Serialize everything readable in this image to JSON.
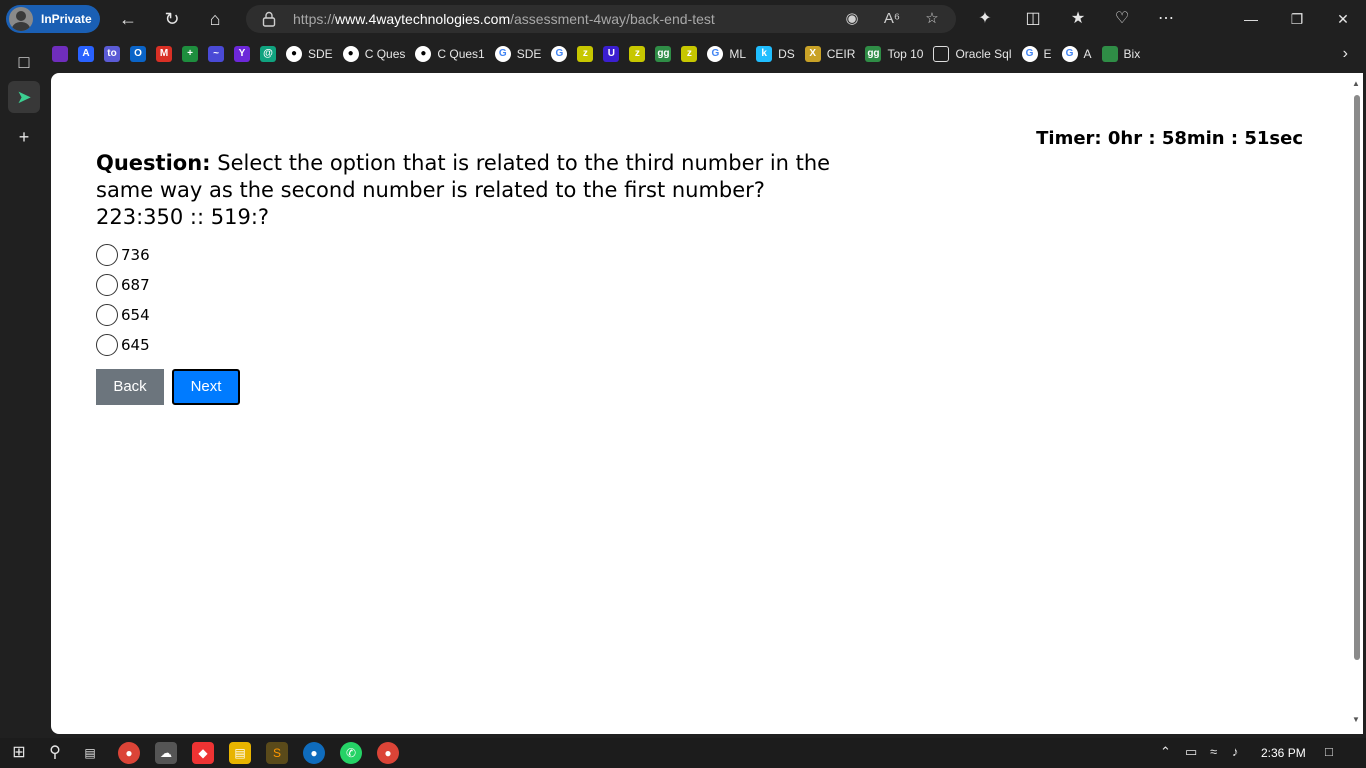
{
  "browser": {
    "profile_label": "InPrivate",
    "url_prefix": "https://",
    "url_host": "www.4waytechnologies.com",
    "url_path": "/assessment-4way/back-end-test"
  },
  "favorites": [
    {
      "label": "",
      "icon": "shield-purple",
      "color": "#6f2dbd"
    },
    {
      "label": "",
      "icon": "A",
      "color": "#2962ff"
    },
    {
      "label": "",
      "icon": "to",
      "color": "#5b5bd6"
    },
    {
      "label": "",
      "icon": "O",
      "color": "#0a64c8"
    },
    {
      "label": "",
      "icon": "M",
      "color": "#d93025"
    },
    {
      "label": "",
      "icon": "+",
      "color": "#1e8e3e"
    },
    {
      "label": "",
      "icon": "~",
      "color": "#4a4ad6"
    },
    {
      "label": "",
      "icon": "Y",
      "color": "#6d28d9"
    },
    {
      "label": "",
      "icon": "@",
      "color": "#10a37f"
    },
    {
      "label": "SDE",
      "icon": "github",
      "color": "#000000"
    },
    {
      "label": "C Ques",
      "icon": "github",
      "color": "#000000"
    },
    {
      "label": "C Ques1",
      "icon": "github",
      "color": "#000000"
    },
    {
      "label": "SDE",
      "icon": "G",
      "color": "#4285f4"
    },
    {
      "label": "",
      "icon": "G",
      "color": "#4285f4"
    },
    {
      "label": "",
      "icon": "z",
      "color": "#c7c700"
    },
    {
      "label": "",
      "icon": "U",
      "color": "#3b1fd0"
    },
    {
      "label": "",
      "icon": "z",
      "color": "#c7c700"
    },
    {
      "label": "",
      "icon": "gg",
      "color": "#2f8d46"
    },
    {
      "label": "",
      "icon": "z",
      "color": "#c7c700"
    },
    {
      "label": "ML",
      "icon": "G",
      "color": "#4285f4"
    },
    {
      "label": "DS",
      "icon": "k",
      "color": "#20beff"
    },
    {
      "label": "CEIR",
      "icon": "X",
      "color": "#c9a227"
    },
    {
      "label": "Top 10",
      "icon": "gg",
      "color": "#2f8d46"
    },
    {
      "label": "Oracle Sql",
      "icon": "doc",
      "color": "#555555"
    },
    {
      "label": "E",
      "icon": "G",
      "color": "#4285f4"
    },
    {
      "label": "A",
      "icon": "G",
      "color": "#4285f4"
    },
    {
      "label": "Bix",
      "icon": "bix",
      "color": "#2f8d46"
    }
  ],
  "quiz": {
    "timer": "Timer: 0hr : 58min : 51sec",
    "question_label": "Question:",
    "question_text": " Select the option that is related to the third number in the same way as the second number is related to the first number? 223:350 :: 519:?",
    "options": [
      "736",
      "687",
      "654",
      "645"
    ],
    "back_label": "Back",
    "next_label": "Next"
  },
  "taskbar": {
    "time": "2:36 PM"
  },
  "colors": {
    "accent_blue": "#007bff",
    "back_gray": "#6c757d",
    "inprivate_blue": "#1a5fb4"
  }
}
